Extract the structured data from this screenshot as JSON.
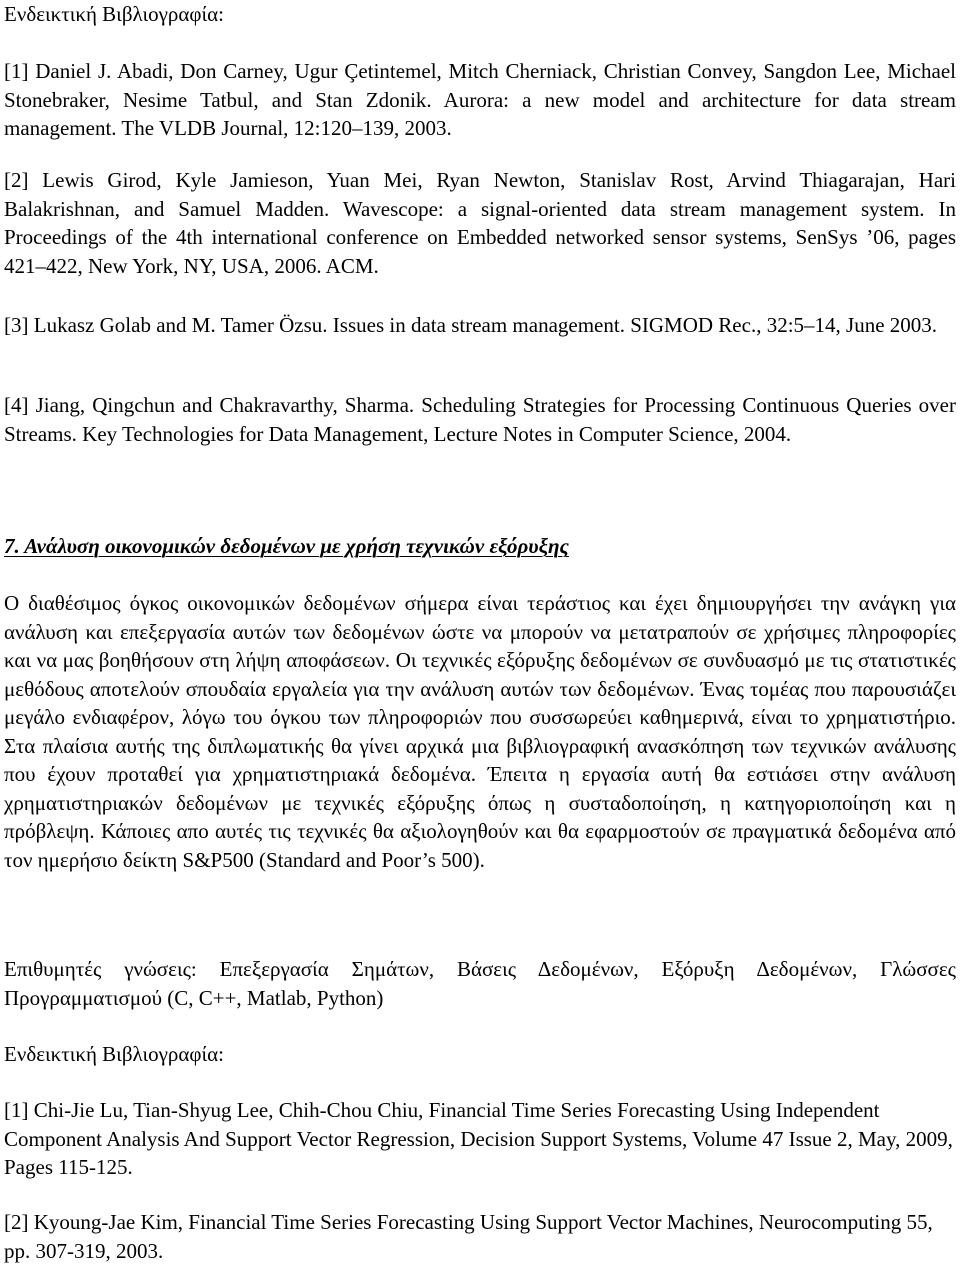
{
  "section_a": {
    "bibliography_label": "Ενδεικτική Βιβλιογραφία:",
    "references": [
      "[1] Daniel J. Abadi, Don Carney, Ugur Çetintemel, Mitch Cherniack, Christian Convey, Sangdon Lee, Michael Stonebraker, Nesime Tatbul, and Stan Zdonik. Aurora: a new model and architecture for data stream management. The VLDB Journal, 12:120–139, 2003.",
      "[2] Lewis Girod, Kyle Jamieson, Yuan Mei, Ryan Newton, Stanislav Rost, Arvind Thiagarajan, Hari Balakrishnan, and Samuel Madden. Wavescope: a signal-oriented data stream management system. In Proceedings of the 4th international conference on Embedded networked sensor systems, SenSys ’06, pages 421–422, New York, NY, USA, 2006. ACM.",
      "[3] Lukasz Golab and M. Tamer Özsu. Issues in data stream management. SIGMOD Rec., 32:5–14, June 2003.",
      "[4] Jiang, Qingchun and Chakravarthy, Sharma. Scheduling Strategies for Processing Continuous Queries over Streams. Key Technologies for Data Management, Lecture Notes in Computer Science, 2004."
    ]
  },
  "section_7": {
    "heading": "7. Ανάλυση οικονομικών δεδομένων με χρήση τεχνικών εξόρυξης",
    "description": "Ο διαθέσιμος όγκος οικονομικών δεδομένων σήμερα είναι τεράστιος και έχει δημιουργήσει την ανάγκη για ανάλυση και επεξεργασία αυτών των δεδομένων ώστε να μπορούν να μετατραπούν σε χρήσιμες πληροφορίες και να μας βοηθήσουν στη λήψη αποφάσεων. Οι τεχνικές εξόρυξης δεδομένων σε συνδυασμό με τις στατιστικές μεθόδους αποτελούν σπουδαία εργαλεία για την ανάλυση αυτών των δεδομένων. Ένας τομέας που παρουσιάζει μεγάλο ενδιαφέρον, λόγω του όγκου των πληροφοριών που συσσωρεύει καθημερινά, είναι το χρηματιστήριο. Στα πλαίσια αυτής της διπλωματικής θα γίνει αρχικά μια βιβλιογραφική ανασκόπηση των τεχνικών ανάλυσης που έχουν προταθεί για χρηματιστηριακά δεδομένα. Έπειτα η εργασία αυτή θα εστιάσει στην ανάλυση χρηματιστηριακών δεδομένων με τεχνικές εξόρυξης όπως η συσταδοποίηση, η κατηγοριοποίηση και η πρόβλεψη. Κάποιες απο αυτές τις τεχνικές θα αξιολογηθούν και θα εφαρμοστούν σε πραγματικά δεδομένα από τον ημερήσιο δείκτη S&P500 (Standard and Poor’s 500).",
    "desired_skills": "Επιθυμητές γνώσεις: Επεξεργασία Σημάτων, Βάσεις Δεδομένων, Εξόρυξη Δεδομένων, Γλώσσες Προγραμματισμού (C, C++, Matlab, Python)",
    "bibliography_label": "Ενδεικτική Βιβλιογραφία:",
    "references": [
      "[1] Chi-Jie Lu, Tian-Shyug Lee, Chih-Chou Chiu, Financial Time Series Forecasting Using Independent Component Analysis And Support Vector Regression, Decision Support Systems, Volume 47 Issue 2, May, 2009, Pages 115-125.",
      "[2] Kyoung-Jae Kim, Financial Time Series Forecasting Using Support Vector Machines, Neurocomputing 55, pp. 307-319, 2003."
    ]
  }
}
